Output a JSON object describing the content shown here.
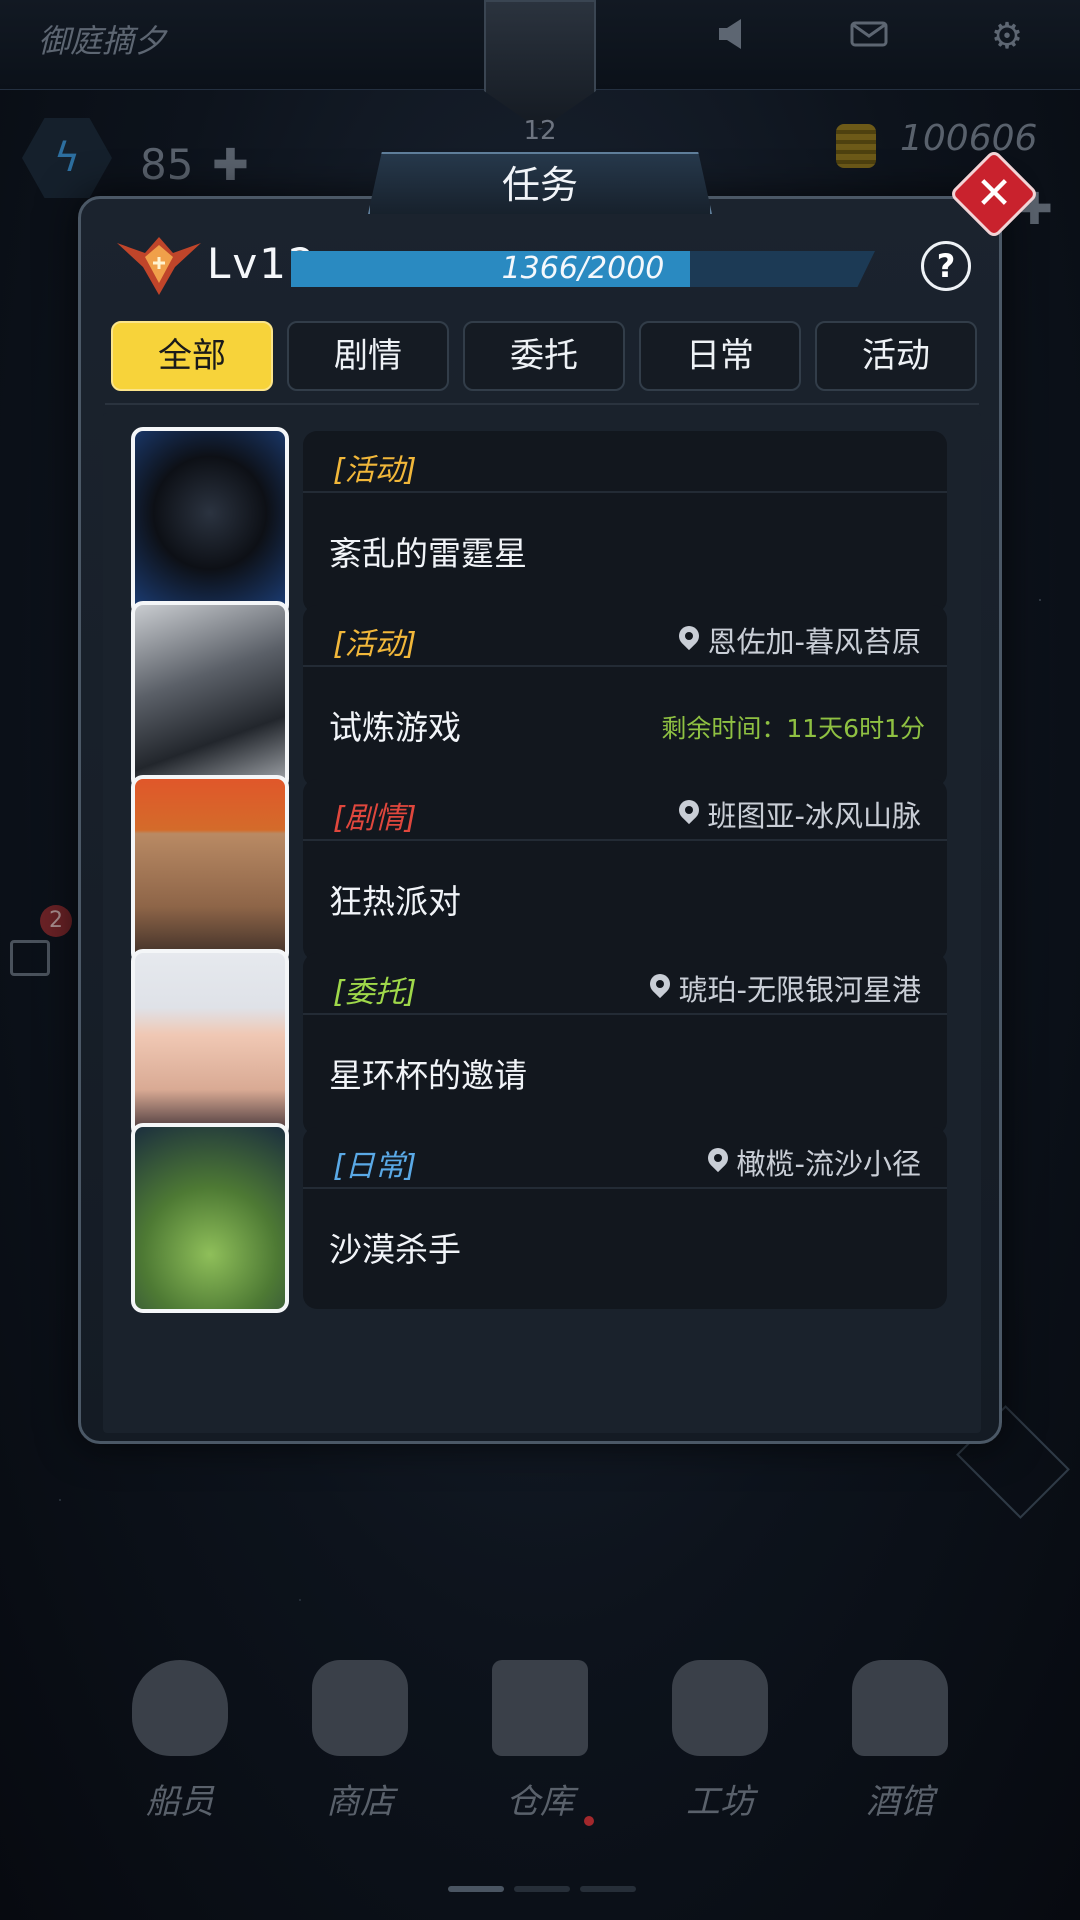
{
  "hud": {
    "title": "御庭摘夕",
    "avatar_level": "12",
    "energy": "85",
    "coins": "100606",
    "chat_badge": "2"
  },
  "modal": {
    "title": "任务",
    "level_label": "Lv12",
    "xp_text": "1366/2000",
    "xp_progress": 0.683,
    "help_label": "?",
    "close_label": "✕"
  },
  "filters": [
    "全部",
    "剧情",
    "委托",
    "日常",
    "活动"
  ],
  "quests": [
    {
      "type": "[活动]",
      "type_color": "#f1b73a",
      "name": "紊乱的雷霆星",
      "location": "",
      "timer": "",
      "portrait": "hooded-figure"
    },
    {
      "type": "[活动]",
      "type_color": "#f1b73a",
      "name": "试炼游戏",
      "location": "恩佐加-暮风苔原",
      "timer": "剩余时间：11天6时1分",
      "portrait": "armored-helmet"
    },
    {
      "type": "[剧情]",
      "type_color": "#e0473d",
      "name": "狂热派对",
      "location": "班图亚-冰风山脉",
      "timer": "",
      "portrait": "orange-haired-brute"
    },
    {
      "type": "[委托]",
      "type_color": "#9fd84a",
      "name": "星环杯的邀请",
      "location": "琥珀-无限银河星港",
      "timer": "",
      "portrait": "silver-haired-woman"
    },
    {
      "type": "[日常]",
      "type_color": "#5aa9e6",
      "name": "沙漠杀手",
      "location": "橄榄-流沙小径",
      "timer": "",
      "portrait": "toad-creature"
    }
  ],
  "nav": [
    "船员",
    "商店",
    "仓库",
    "工坊",
    "酒馆"
  ]
}
